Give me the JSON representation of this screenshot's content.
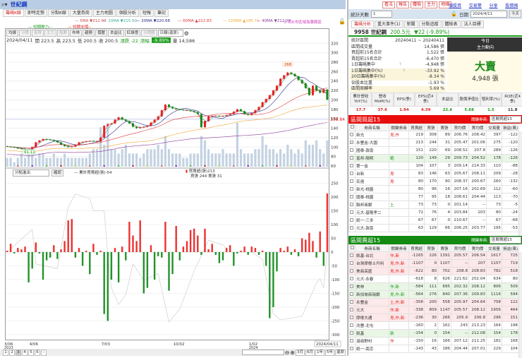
{
  "title": "世紀鋼",
  "tabs": [
    "籌碼K線",
    "即時走勢",
    "分點K線",
    "大量券商",
    "主力地圖",
    "個股分析",
    "短報",
    "筆記"
  ],
  "ma_legend": [
    {
      "label": "5MA ▼212.90",
      "color": "#d04848"
    },
    {
      "label": "10MA ▼215.50",
      "color": "#3aaa98"
    },
    {
      "label": "20MA ▼220.68",
      "color": "#2a2a8a"
    },
    {
      "label": "60MA ▲222.83",
      "color": "#e03838"
    },
    {
      "label": "120MA ▲195.71",
      "color": "#f0a838"
    },
    {
      "label": "40MA ▼212.08",
      "color": "#8a3a9a"
    }
  ],
  "support_legend": [
    {
      "label": "短期壓力--",
      "color": "#1a9a1a"
    },
    {
      "label": "短期支撐--",
      "color": "#e02020"
    }
  ],
  "legend_note": "⊙ 紅K市區域為籌碼區",
  "toolbar": {
    "buttons": [
      {
        "l": "均線",
        "d": false
      },
      {
        "l": "分價",
        "d": true
      },
      {
        "l": "投資",
        "d": true
      },
      {
        "l": "主力",
        "d": true
      },
      {
        "l": "點數",
        "d": true
      },
      {
        "l": "布林",
        "d": false
      },
      {
        "l": "趨勢",
        "d": false
      },
      {
        "l": "撐壓",
        "d": false
      },
      {
        "l": "本益比",
        "d": false
      },
      {
        "l": "紅綠燈",
        "d": false
      },
      {
        "l": "分價圖",
        "d": true
      }
    ],
    "period": "日線(還原)"
  },
  "info": {
    "date": "2024/04/11",
    "open": "開 223.5",
    "high": "高 223.5",
    "low": "低 200.5",
    "close": "收 200.5",
    "change": "漲跌 -22",
    "pct_label": "漲幅",
    "pct": "-9.89%",
    "vol": "量 14,586"
  },
  "price_chart": {
    "y_ticks": [
      320,
      300,
      280,
      260,
      240,
      220,
      200,
      180,
      160,
      140,
      120,
      100,
      80,
      60
    ],
    "ref_line": 158.84,
    "high_label": "268",
    "low_label": "91.11",
    "closes": [
      101,
      100,
      99,
      97,
      96,
      95,
      94,
      100,
      110,
      114,
      117,
      116,
      115,
      113,
      110,
      105,
      102,
      100,
      101,
      104,
      110,
      111,
      112,
      113,
      112,
      112,
      120,
      145,
      148,
      150,
      158,
      163,
      158,
      155,
      150,
      143,
      140,
      142,
      143,
      145,
      152,
      158,
      165,
      178,
      190,
      185,
      182,
      180,
      179,
      178,
      178,
      176,
      174,
      170,
      142,
      155,
      165,
      166,
      166,
      165,
      166,
      168,
      170,
      175,
      180,
      176,
      170,
      168,
      172,
      178,
      185,
      195,
      202,
      210,
      220,
      230,
      245,
      252,
      258,
      255,
      250,
      242,
      235,
      225,
      210,
      230,
      220,
      215,
      222,
      200.5
    ],
    "volume": [
      2,
      2,
      1,
      2,
      3,
      2,
      4,
      3,
      2,
      3,
      3,
      2,
      2,
      3,
      2,
      2,
      3,
      2,
      2,
      2,
      2,
      2,
      2,
      3,
      4,
      4,
      9,
      5,
      10,
      4,
      4,
      3,
      4,
      5,
      3,
      3,
      3,
      2,
      3,
      4,
      4,
      4,
      5,
      4,
      7,
      4,
      3,
      3,
      3,
      2,
      2,
      3,
      3,
      3,
      7,
      6,
      4,
      3,
      3,
      3,
      4,
      3,
      3,
      3,
      10,
      4,
      3,
      3,
      3,
      4,
      4,
      7,
      5,
      4,
      4,
      3,
      4,
      3,
      5,
      4,
      3,
      4,
      3,
      6,
      5,
      5,
      6,
      4,
      3,
      6
    ]
  },
  "lower": {
    "select": "分點進出",
    "confirm": "確認",
    "cum_label": "— 累計買賣超(張)-54",
    "net_label": "買賣超(張)213",
    "buysell_label": "買張 244 賣張 31",
    "y_ticks": [
      250,
      200,
      150,
      100,
      50,
      0,
      -50,
      -100,
      -150,
      -200,
      -250,
      -300
    ],
    "net": [
      5,
      30,
      -5,
      15,
      10,
      20,
      -110,
      -60,
      35,
      -5,
      -100,
      -30,
      -20,
      25,
      -25,
      10,
      40,
      115,
      120,
      -20,
      15,
      -50,
      5,
      -80,
      30,
      -10,
      5,
      -225,
      -250,
      -100,
      15,
      -110,
      20,
      -30,
      110,
      60,
      40,
      115,
      -150,
      -130,
      25,
      -100,
      -15,
      -20,
      110,
      -140,
      -80,
      95,
      -30,
      20,
      40,
      80,
      85,
      60,
      -10,
      85,
      10,
      30,
      -10,
      -40,
      -30,
      15,
      25,
      -50,
      -5,
      5,
      20,
      -10,
      20,
      15,
      -10,
      5,
      -50,
      -240,
      -200,
      -70,
      15,
      5,
      20,
      -10,
      10,
      -15,
      50,
      45,
      70,
      40,
      -20,
      75,
      -50,
      213
    ],
    "cum_pts": [
      [
        0,
        0
      ],
      [
        7,
        82
      ],
      [
        8,
        -43
      ],
      [
        14,
        -60
      ],
      [
        17,
        164
      ],
      [
        19,
        211
      ],
      [
        23,
        194
      ],
      [
        24,
        150
      ],
      [
        27,
        150
      ],
      [
        28,
        -9
      ],
      [
        29,
        -130
      ],
      [
        31,
        -190
      ],
      [
        33,
        -155
      ],
      [
        35,
        -43
      ],
      [
        38,
        -103
      ],
      [
        42,
        -78
      ],
      [
        45,
        -254
      ],
      [
        48,
        -207
      ],
      [
        52,
        -69
      ],
      [
        56,
        43
      ],
      [
        60,
        26
      ],
      [
        62,
        0
      ],
      [
        68,
        0
      ],
      [
        71,
        -26
      ],
      [
        74,
        -224
      ],
      [
        76,
        -246
      ],
      [
        82,
        -233
      ],
      [
        86,
        -112
      ],
      [
        87,
        -97
      ],
      [
        88,
        -130
      ],
      [
        89,
        9
      ]
    ]
  },
  "x_dates": [
    {
      "i": 0,
      "l": "3/06",
      "s": "2023"
    },
    {
      "i": 7,
      "l": "4/06",
      "s": ""
    },
    {
      "i": 27,
      "l": "7/03",
      "s": ""
    },
    {
      "i": 47,
      "l": "10/02",
      "s": ""
    },
    {
      "i": 68,
      "l": "1/02",
      "s": "2024"
    }
  ],
  "last_date": "2024/04/11",
  "pages": [
    "1",
    "2",
    "3",
    "4",
    "5",
    "6"
  ],
  "zoom_btns": [
    "3月",
    "6月",
    "1年",
    "5年",
    "還原"
  ],
  "right": {
    "top_btns": [
      "看法",
      "報告",
      "體檢",
      "主力",
      "地緣"
    ],
    "links": [
      "個股資訊",
      "交易警示",
      "分享易",
      "股價預測"
    ],
    "days_label": "統計天數",
    "days": "1",
    "date_label": "日期",
    "date": "2024/4/11",
    "today": "今天",
    "tabs": [
      "籌碼分析",
      "重大事件(1)",
      "新聞",
      "分點追蹤",
      "體檢表",
      "法人目標"
    ],
    "stock": "9958 世紀鋼",
    "price": "200.5元",
    "change": "▼22 (-9.89%)",
    "stats": [
      {
        "k": "統計區間",
        "v": "20240411 ~ 20240411",
        "b": false
      },
      {
        "k": "區間成交量",
        "v": "14,586 張",
        "b": false
      },
      {
        "k": "買超前15名合計",
        "v": "1,522 張",
        "b": false
      },
      {
        "k": "賣超前15名合計",
        "v": "-6,470 張",
        "b": false
      },
      {
        "k": "1日籌碼集中",
        "v": "-4,948 張",
        "b": false
      },
      {
        "k": "1日籌碼集中(%)",
        "v": "-33.92 %",
        "b": true
      },
      {
        "k": "20日籌碼集中(%)",
        "v": "-8.34 %",
        "b": true
      },
      {
        "k": "佔股本比重",
        "v": "-1.93 %",
        "b": false
      },
      {
        "k": "區間周轉率",
        "v": "5.69 %",
        "b": true
      }
    ],
    "today_h1": "今日",
    "today_h2": "主力動向",
    "action": "大賣",
    "action_vol": "4,948 張",
    "metrics": [
      {
        "h": "累計營收YoY(%)",
        "v": "17.7",
        "c": "#e02020"
      },
      {
        "h": "營收MoM(%)",
        "v": "37.6",
        "c": "#e02020"
      },
      {
        "h": "EPS(季)",
        "v": "1.94",
        "c": "#e02020"
      },
      {
        "h": "EPS(近4季)",
        "v": "4.39",
        "c": "#e02020"
      },
      {
        "h": "本益比",
        "v": "22.6",
        "c": "#1a9a1a"
      },
      {
        "h": "股價淨值比",
        "v": "5.68",
        "c": "#1a9a1a"
      },
      {
        "h": "殖利率(%)",
        "v": "1.5",
        "c": "#1a9a1a"
      },
      {
        "h": "ROE(近4季)",
        "v": "11.8",
        "c": "#333333"
      }
    ],
    "key_label": "關鍵券商:",
    "key_select": "區間買超15",
    "key_select2": "區間賣超15",
    "cols": [
      "券商名稱",
      "關鍵券商",
      "買賣超",
      "買張",
      "賣張",
      "買均價",
      "賣均價",
      "交易量",
      "損益(萬)"
    ],
    "buy_title": "區間買超15",
    "sell_title": "區間賣超15",
    "buy": [
      {
        "r": [
          "新光",
          "見,作",
          "219",
          "308",
          "89",
          "206.76",
          "208.42",
          "397",
          "-122"
        ],
        "bg": "",
        "ck": false
      },
      {
        "r": [
          "永豐金-大園",
          "",
          "213",
          "244",
          "31",
          "205.47",
          "201.06",
          "275",
          "-120"
        ],
        "bg": "",
        "ck": true
      },
      {
        "r": [
          "國泰-敦南",
          "",
          "151",
          "220",
          "69",
          "208.52",
          "207.8",
          "289",
          "-126"
        ],
        "bg": "",
        "ck": false
      },
      {
        "r": [
          "富邦-陽明",
          "範",
          "120",
          "149",
          "29",
          "209.73",
          "204.52",
          "178",
          "-126"
        ],
        "bg": "gn",
        "ck": false
      },
      {
        "r": [
          "第一金",
          "",
          "104",
          "107",
          "3",
          "209.14",
          "214.33",
          "110",
          "-88"
        ],
        "bg": "",
        "ck": false
      },
      {
        "r": [
          "台新",
          "見",
          "83",
          "146",
          "63",
          "205.67",
          "208.11",
          "209",
          "-28"
        ],
        "bg": "",
        "ck": false
      },
      {
        "r": [
          "宏遠",
          "見",
          "80",
          "170",
          "90",
          "208.37",
          "200.67",
          "260",
          "-132"
        ],
        "bg": "",
        "ck": false
      },
      {
        "r": [
          "新光-桃園",
          "",
          "80",
          "96",
          "16",
          "207.16",
          "202.69",
          "112",
          "-60"
        ],
        "bg": "",
        "ck": false
      },
      {
        "r": [
          "國泰-桃園",
          "",
          "77",
          "95",
          "18",
          "208.61",
          "204.44",
          "113",
          "-70"
        ],
        "bg": "",
        "ck": false
      },
      {
        "r": [
          "聯邦商銀",
          "土",
          "73",
          "73",
          "0",
          "201.14",
          "--",
          "73",
          "-5"
        ],
        "bg": "",
        "ck": false
      },
      {
        "r": [
          "元大-基隆孝二",
          "",
          "72",
          "76",
          "4",
          "203.84",
          "203",
          "80",
          "-24"
        ],
        "bg": "",
        "ck": false
      },
      {
        "r": [
          "統一-三多",
          "",
          "67",
          "67",
          "0",
          "210.67",
          "--",
          "67",
          "-68"
        ],
        "bg": "",
        "ck": false
      },
      {
        "r": [
          "元大-敦南",
          "",
          "63",
          "129",
          "66",
          "206.25",
          "203.77",
          "195",
          "-53"
        ],
        "bg": "",
        "ck": false
      }
    ],
    "sell": [
      {
        "r": [
          "凱基-台北",
          "作,新",
          "-1165",
          "226",
          "1391",
          "205.57",
          "206.54",
          "1617",
          "725"
        ],
        "bg": "pk"
      },
      {
        "r": [
          "台灣摩根士丹利",
          "見,作,新",
          "-1107",
          "0",
          "1107",
          "--",
          "207",
          "1107",
          "719"
        ],
        "bg": "pk"
      },
      {
        "r": [
          "美商高盛",
          "見,作,新",
          "-622",
          "80",
          "702",
          "208.8",
          "208.83",
          "782",
          "518"
        ],
        "bg": "pk"
      },
      {
        "r": [
          "元大-永春",
          "",
          "-618",
          "8",
          "626",
          "221.62",
          "202.04",
          "634",
          "80"
        ],
        "bg": ""
      },
      {
        "r": [
          "美林",
          "作,新",
          "-584",
          "111",
          "695",
          "202.32",
          "208.12",
          "806",
          "509"
        ],
        "bg": "gn"
      },
      {
        "r": [
          "新加坡商瑞銀",
          "見,作,新",
          "-564",
          "276",
          "840",
          "207.36",
          "209.83",
          "1116",
          "594"
        ],
        "bg": "gn"
      },
      {
        "r": [
          "永豐金",
          "土,作,新",
          "-358",
          "200",
          "558",
          "205.97",
          "204.64",
          "758",
          "122"
        ],
        "bg": "pk"
      },
      {
        "r": [
          "元大",
          "作,新",
          "-338",
          "809",
          "1147",
          "205.57",
          "208.12",
          "1956",
          "464"
        ],
        "bg": "pk"
      },
      {
        "r": [
          "摩根大通",
          "見,作,新",
          "-236",
          "30",
          "266",
          "205.9",
          "206.8",
          "296",
          "151"
        ],
        "bg": "pk"
      },
      {
        "r": [
          "兆豐-北屯",
          "",
          "-160",
          "2",
          "162",
          "243",
          "213.23",
          "164",
          "198"
        ],
        "bg": ""
      },
      {
        "r": [
          "凱基",
          "新",
          "-154",
          "0",
          "154",
          "--",
          "212.08",
          "154",
          "178"
        ],
        "bg": "gn"
      },
      {
        "r": [
          "港商野村",
          "作",
          "-150",
          "16",
          "166",
          "207.12",
          "211.25",
          "182",
          "168"
        ],
        "bg": ""
      },
      {
        "r": [
          "統一-南京",
          "",
          "-143",
          "43",
          "186",
          "204.44",
          "207.01",
          "229",
          "104"
        ],
        "bg": ""
      }
    ]
  }
}
